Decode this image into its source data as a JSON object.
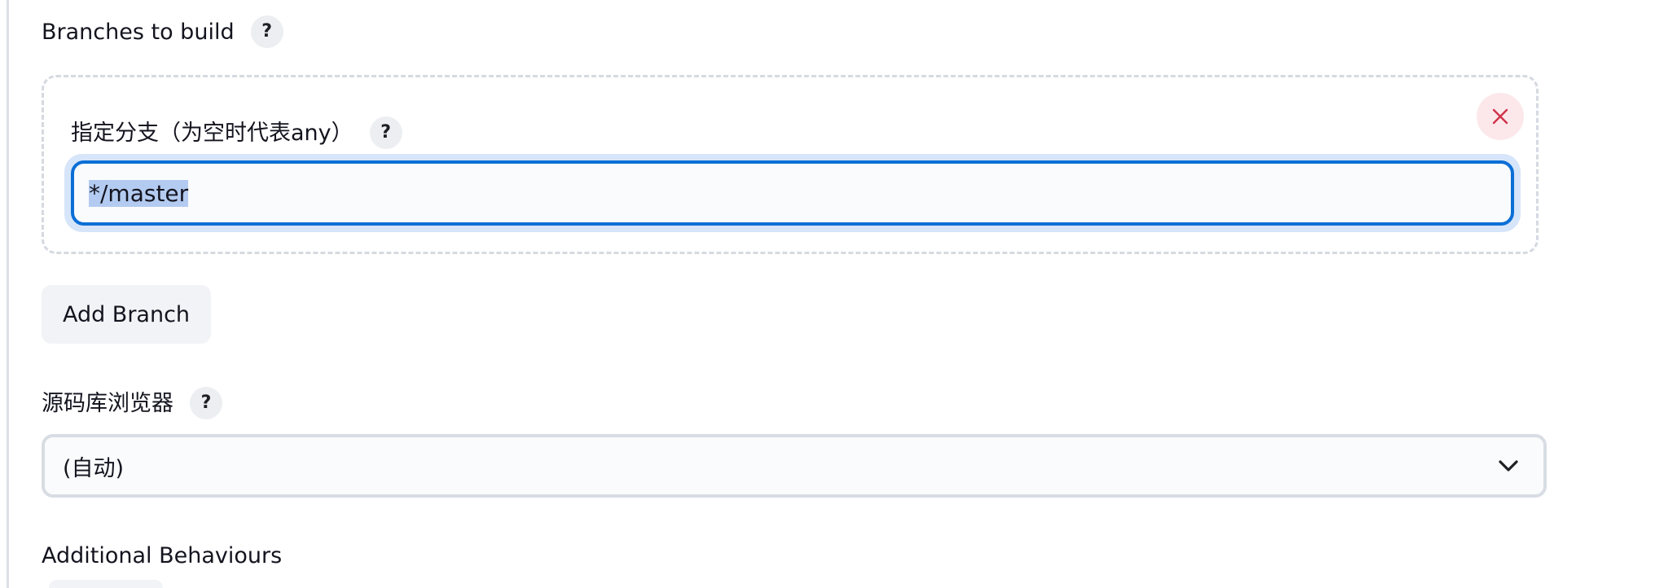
{
  "branches": {
    "label": "Branches to build",
    "help": "?",
    "specifier": {
      "label": "指定分支（为空时代表any）",
      "help": "?",
      "value": "*/master"
    },
    "add_button": "Add Branch"
  },
  "browser": {
    "label": "源码库浏览器",
    "help": "?",
    "selected": "(自动)"
  },
  "additional": {
    "label": "Additional Behaviours"
  },
  "colors": {
    "focus_border": "#0b6fd6",
    "selection": "#b3cbf0",
    "delete": "#d0324b"
  }
}
